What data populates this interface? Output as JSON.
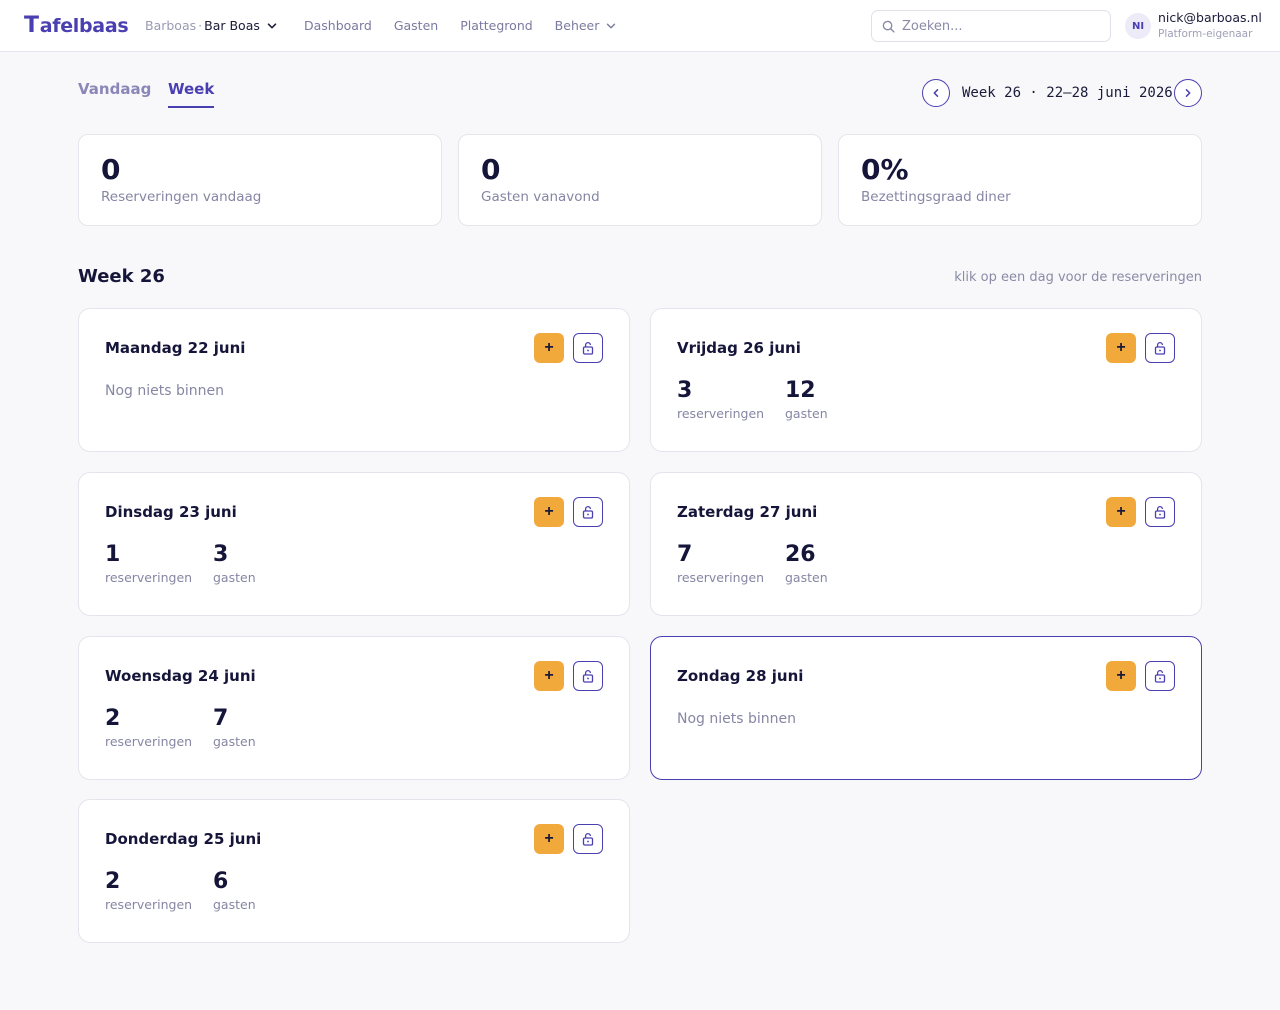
{
  "brand": {
    "logo_mark": "T",
    "logo_text": "afelbaas"
  },
  "org": {
    "parent": "Barboas",
    "separator": "·",
    "name": "Bar Boas"
  },
  "nav": [
    {
      "label": "Dashboard"
    },
    {
      "label": "Gasten"
    },
    {
      "label": "Plattegrond"
    },
    {
      "label": "Beheer"
    }
  ],
  "search": {
    "placeholder": "Zoeken...",
    "value": ""
  },
  "user": {
    "initials": "NI",
    "email": "nick@barboas.nl",
    "role": "Platform-eigenaar"
  },
  "tabs": {
    "today": "Vandaag",
    "week": "Week",
    "active": "week"
  },
  "week_nav": {
    "label": "Week 26 · 22–28 juni 2026"
  },
  "stats": [
    {
      "value": "0",
      "label": "Reserveringen vandaag"
    },
    {
      "value": "0",
      "label": "Gasten vanavond"
    },
    {
      "value": "0%",
      "label": "Bezettingsgraad diner"
    }
  ],
  "section": {
    "title": "Week 26",
    "hint": "klik op een dag voor de reserveringen"
  },
  "days": [
    {
      "title": "Maandag 22 juni",
      "empty": "Nog niets binnen"
    },
    {
      "title": "Dinsdag 23 juni",
      "reservations": "1",
      "reservations_label": "reserveringen",
      "guests": "3",
      "guests_label": "gasten"
    },
    {
      "title": "Woensdag 24 juni",
      "reservations": "2",
      "reservations_label": "reserveringen",
      "guests": "7",
      "guests_label": "gasten"
    },
    {
      "title": "Donderdag 25 juni",
      "reservations": "2",
      "reservations_label": "reserveringen",
      "guests": "6",
      "guests_label": "gasten"
    },
    {
      "title": "Vrijdag 26 juni",
      "reservations": "3",
      "reservations_label": "reserveringen",
      "guests": "12",
      "guests_label": "gasten"
    },
    {
      "title": "Zaterdag 27 juni",
      "reservations": "7",
      "reservations_label": "reserveringen",
      "guests": "26",
      "guests_label": "gasten"
    },
    {
      "title": "Zondag 28 juni",
      "empty": "Nog niets binnen",
      "selected": true
    }
  ],
  "buttons": {
    "add_label": "+"
  },
  "colors": {
    "accent": "#4a3fb0",
    "add_button": "#f2a93b",
    "text": "#15153a",
    "muted": "#8686a4"
  },
  "icons": {
    "search": "search-icon",
    "chevron": "chevron-down-icon",
    "prev": "chevron-left-icon",
    "next": "chevron-right-icon",
    "lock": "unlock-icon",
    "add": "plus-icon"
  }
}
